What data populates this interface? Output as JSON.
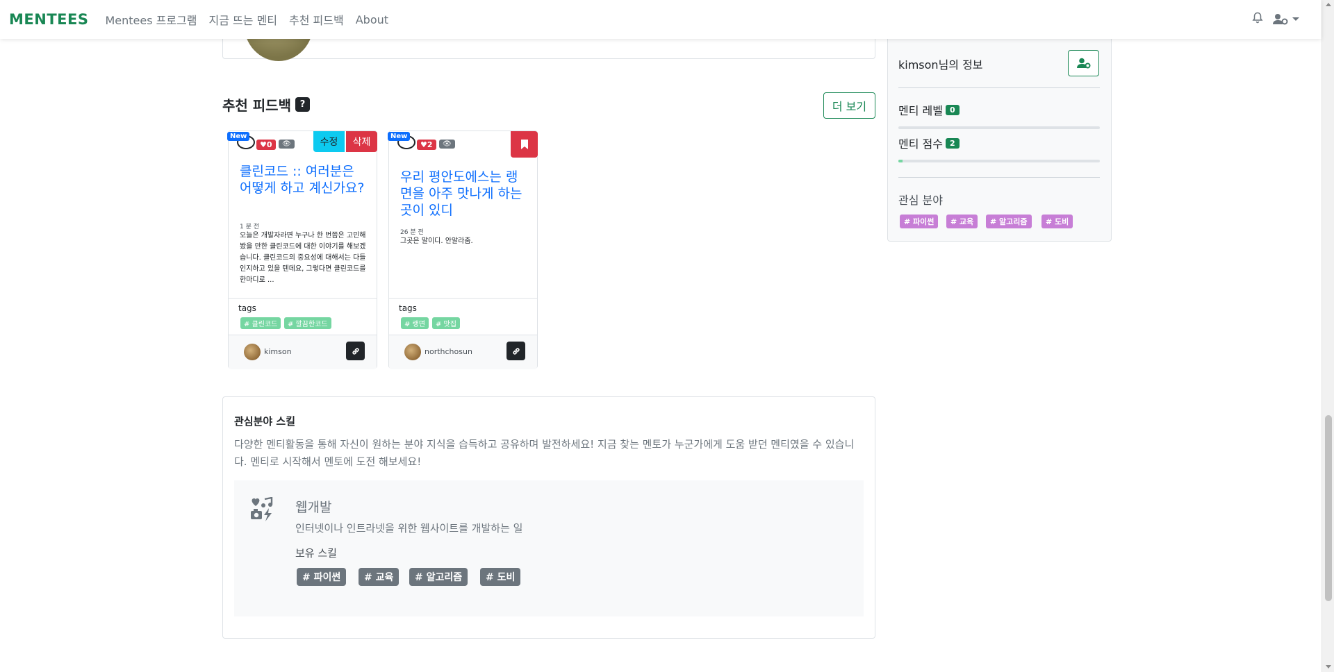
{
  "navbar": {
    "brand": "MENTEES",
    "links": [
      "Mentees 프로그램",
      "지금 뜨는 멘티",
      "추천 피드백",
      "About"
    ]
  },
  "feedback_section": {
    "title": "추천 피드백",
    "help_badge": "?",
    "more_button": "더 보기",
    "cards": [
      {
        "new_badge": "New",
        "likes": "0",
        "edit_label": "수정",
        "delete_label": "삭제",
        "title": "클린코드 :: 여러분은 어떻게 하고 계신가요?",
        "time": "1 분 전",
        "body": "오늘은 개발자라면 누구나 한 번쯤은 고민해 봤을 만한 클린코드에 대한 이야기를 해보겠습니다. 클린코드의 중요성에 대해서는 다들 인지하고 있을 텐데요, 그렇다면 클린코드를 한마디로 ...",
        "tags_label": "tags",
        "tags": [
          "# 클린코드",
          "# 깔끔한코드"
        ],
        "author": "kimson"
      },
      {
        "new_badge": "New",
        "likes": "2",
        "title": "우리 평안도에스는 랭면을 아주 맛나게 하는 곳이 있디",
        "time": "26 분 전",
        "body": "그곳은 말이디. 안알라줌.",
        "tags_label": "tags",
        "tags": [
          "# 랭면",
          "# 맛집"
        ],
        "author": "northchosun"
      }
    ]
  },
  "skills_section": {
    "heading": "관심분야 스킬",
    "description": "다양한 멘티활동을 통해 자신이 원하는 분야 지식을 습득하고 공유하며 발전하세요! 지금 찾는 멘토가 누군가에게 도움 받던 멘티였을 수 있습니다. 멘티로 시작해서 멘토에 도전 해보세요!",
    "skill": {
      "icon": "icons-heart-music-camera-bolt",
      "name": "웹개발",
      "description": "인터넷이나 인트라넷을 위한 웹사이트를 개발하는 일",
      "owned_label": "보유 스킬",
      "tags": [
        "# 파이썬",
        "# 교육",
        "# 알고리즘",
        "# 도비"
      ]
    }
  },
  "sidebar": {
    "user_info": "kimson님의 정보",
    "level_label": "멘티 레벨",
    "level_value": "0",
    "level_progress": 0,
    "score_label": "멘티 점수",
    "score_value": "2",
    "score_progress": 0.02,
    "interest_label": "관심 분야",
    "interest_tags": [
      "# 파이썬",
      "# 교육",
      "# 알고리즘",
      "# 도비"
    ]
  },
  "colors": {
    "brand": "#198754",
    "primary": "#0d6efd",
    "danger": "#dc3545",
    "info": "#0dcaf0",
    "tag_green": "#75d6a1",
    "tag_purple": "#c77ed6",
    "secondary": "#6c757d"
  }
}
